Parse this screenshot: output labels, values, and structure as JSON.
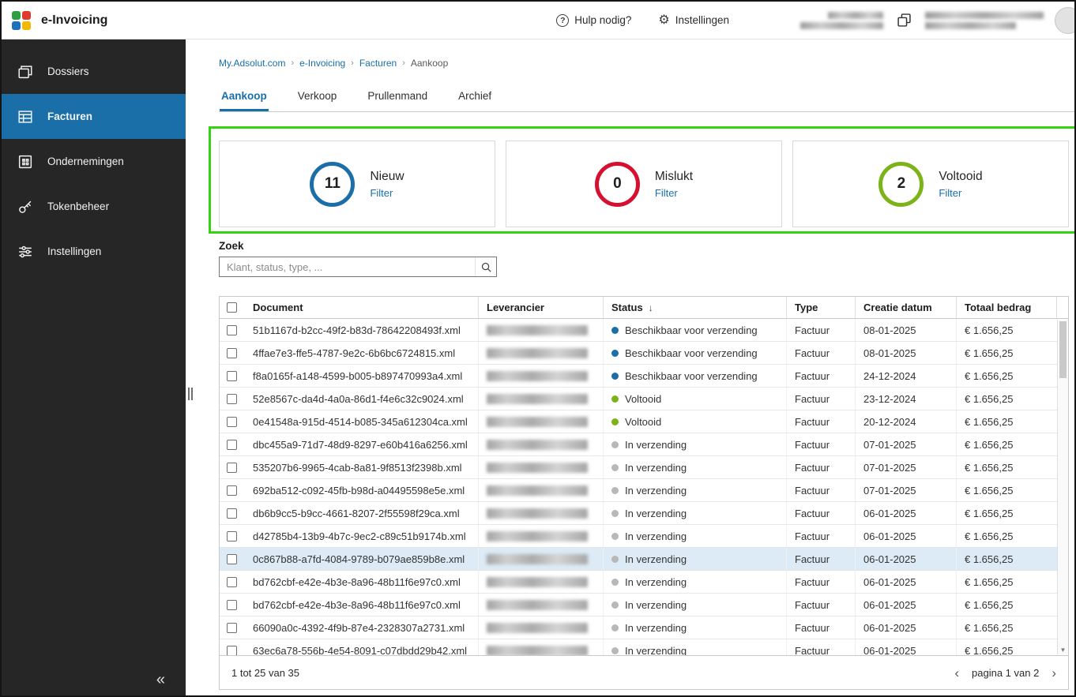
{
  "theme": {
    "accent": "#1a6fa8",
    "annotation": "#35d313"
  },
  "topbar": {
    "app_title": "e-Invoicing",
    "help_label": "Hulp nodig?",
    "settings_label": "Instellingen",
    "logo_colors": [
      "#2f9e41",
      "#e03a2f",
      "#1d71b8",
      "#f5b800"
    ],
    "icons": {
      "help": "help-icon",
      "settings": "gear-icon",
      "workspace": "overlapping-squares-icon"
    }
  },
  "sidebar": {
    "items": [
      {
        "label": "Dossiers",
        "icon": "dossiers-icon",
        "active": false
      },
      {
        "label": "Facturen",
        "icon": "invoices-table-icon",
        "active": true
      },
      {
        "label": "Ondernemingen",
        "icon": "building-icon",
        "active": false
      },
      {
        "label": "Tokenbeheer",
        "icon": "key-icon",
        "active": false
      },
      {
        "label": "Instellingen",
        "icon": "sliders-icon",
        "active": false
      }
    ],
    "collapse_label": "«"
  },
  "breadcrumb": {
    "items": [
      "My.Adsolut.com",
      "e-Invoicing",
      "Facturen",
      "Aankoop"
    ],
    "separator": "›"
  },
  "tabs": {
    "items": [
      "Aankoop",
      "Verkoop",
      "Prullenmand",
      "Archief"
    ],
    "active": "Aankoop"
  },
  "cards": [
    {
      "count": "11",
      "label": "Nieuw",
      "link": "Filter",
      "color": "#1a6fa8"
    },
    {
      "count": "0",
      "label": "Mislukt",
      "link": "Filter",
      "color": "#d51030"
    },
    {
      "count": "2",
      "label": "Voltooid",
      "link": "Filter",
      "color": "#7cb318"
    }
  ],
  "search": {
    "label": "Zoek",
    "placeholder": "Klant, status, type, ..."
  },
  "table": {
    "columns": [
      {
        "label": "Document"
      },
      {
        "label": "Leverancier"
      },
      {
        "label": "Status",
        "sort": "desc"
      },
      {
        "label": "Type"
      },
      {
        "label": "Creatie datum"
      },
      {
        "label": "Totaal bedrag"
      }
    ],
    "status_colors": {
      "Beschikbaar voor verzending": "#1a6fa8",
      "Voltooid": "#7cb318",
      "In verzending": "#b8b8b8"
    },
    "rows": [
      {
        "document": "51b1167d-b2cc-49f2-b83d-78642208493f.xml",
        "status": "Beschikbaar voor verzending",
        "type": "Factuur",
        "date": "08-01-2025",
        "amount": "€ 1.656,25",
        "highlighted": false
      },
      {
        "document": "4ffae7e3-ffe5-4787-9e2c-6b6bc6724815.xml",
        "status": "Beschikbaar voor verzending",
        "type": "Factuur",
        "date": "08-01-2025",
        "amount": "€ 1.656,25",
        "highlighted": false
      },
      {
        "document": "f8a0165f-a148-4599-b005-b897470993a4.xml",
        "status": "Beschikbaar voor verzending",
        "type": "Factuur",
        "date": "24-12-2024",
        "amount": "€ 1.656,25",
        "highlighted": false
      },
      {
        "document": "52e8567c-da4d-4a0a-86d1-f4e6c32c9024.xml",
        "status": "Voltooid",
        "type": "Factuur",
        "date": "23-12-2024",
        "amount": "€ 1.656,25",
        "highlighted": false
      },
      {
        "document": "0e41548a-915d-4514-b085-345a612304ca.xml",
        "status": "Voltooid",
        "type": "Factuur",
        "date": "20-12-2024",
        "amount": "€ 1.656,25",
        "highlighted": false
      },
      {
        "document": "dbc455a9-71d7-48d9-8297-e60b416a6256.xml",
        "status": "In verzending",
        "type": "Factuur",
        "date": "07-01-2025",
        "amount": "€ 1.656,25",
        "highlighted": false
      },
      {
        "document": "535207b6-9965-4cab-8a81-9f8513f2398b.xml",
        "status": "In verzending",
        "type": "Factuur",
        "date": "07-01-2025",
        "amount": "€ 1.656,25",
        "highlighted": false
      },
      {
        "document": "692ba512-c092-45fb-b98d-a04495598e5e.xml",
        "status": "In verzending",
        "type": "Factuur",
        "date": "07-01-2025",
        "amount": "€ 1.656,25",
        "highlighted": false
      },
      {
        "document": "db6b9cc5-b9cc-4661-8207-2f55598f29ca.xml",
        "status": "In verzending",
        "type": "Factuur",
        "date": "06-01-2025",
        "amount": "€ 1.656,25",
        "highlighted": false
      },
      {
        "document": "d42785b4-13b9-4b7c-9ec2-c89c51b9174b.xml",
        "status": "In verzending",
        "type": "Factuur",
        "date": "06-01-2025",
        "amount": "€ 1.656,25",
        "highlighted": false
      },
      {
        "document": "0c867b88-a7fd-4084-9789-b079ae859b8e.xml",
        "status": "In verzending",
        "type": "Factuur",
        "date": "06-01-2025",
        "amount": "€ 1.656,25",
        "highlighted": true
      },
      {
        "document": "bd762cbf-e42e-4b3e-8a96-48b11f6e97c0.xml",
        "status": "In verzending",
        "type": "Factuur",
        "date": "06-01-2025",
        "amount": "€ 1.656,25",
        "highlighted": false
      },
      {
        "document": "bd762cbf-e42e-4b3e-8a96-48b11f6e97c0.xml",
        "status": "In verzending",
        "type": "Factuur",
        "date": "06-01-2025",
        "amount": "€ 1.656,25",
        "highlighted": false
      },
      {
        "document": "66090a0c-4392-4f9b-87e4-2328307a2731.xml",
        "status": "In verzending",
        "type": "Factuur",
        "date": "06-01-2025",
        "amount": "€ 1.656,25",
        "highlighted": false
      },
      {
        "document": "63ec6a78-556b-4e54-8091-c07dbdd29b42.xml",
        "status": "In verzending",
        "type": "Factuur",
        "date": "06-01-2025",
        "amount": "€ 1.656,25",
        "highlighted": false
      }
    ]
  },
  "footer": {
    "range": "1 tot 25 van 35",
    "page_label": "pagina 1 van 2"
  }
}
